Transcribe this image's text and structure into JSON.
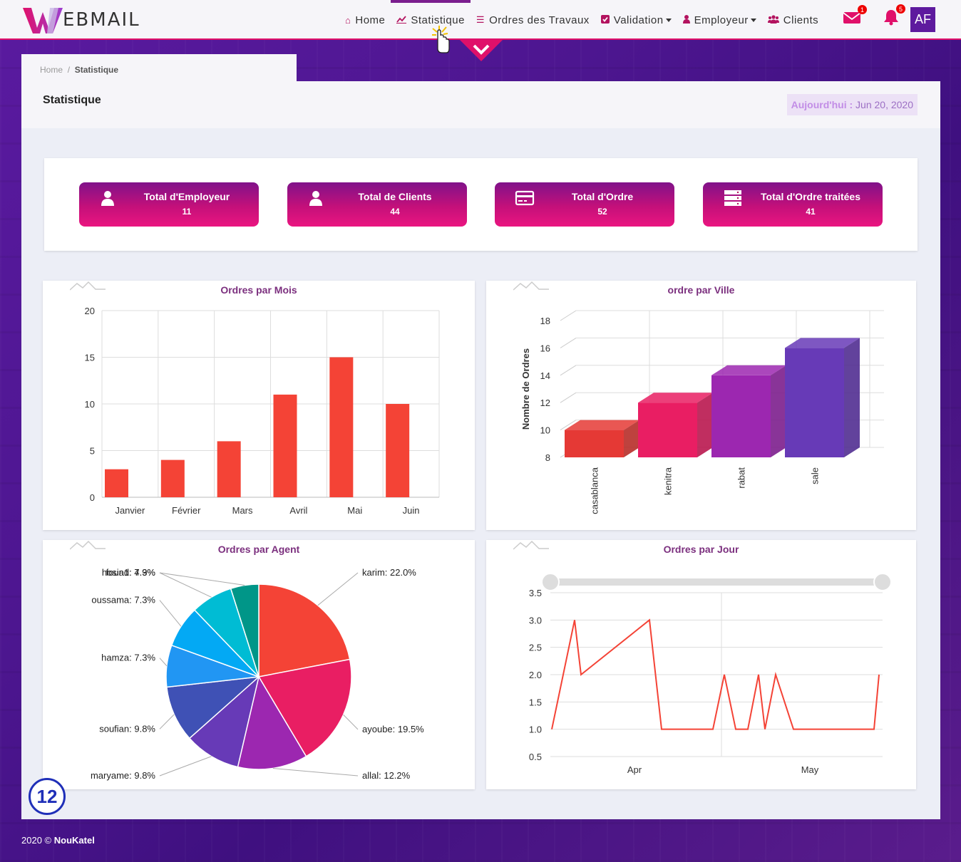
{
  "brand": {
    "logo_letter": "W",
    "logo_text": "EBMAIL"
  },
  "nav": {
    "items": [
      {
        "label": "Home",
        "icon": "home-icon"
      },
      {
        "label": "Statistique",
        "icon": "chart-line-icon",
        "active": true
      },
      {
        "label": "Ordres des Travaux",
        "icon": "list-icon"
      },
      {
        "label": "Validation",
        "icon": "check-square-icon",
        "dropdown": true
      },
      {
        "label": "Employeur",
        "icon": "user-icon",
        "dropdown": true
      },
      {
        "label": "Clients",
        "icon": "users-icon"
      }
    ],
    "mail_badge": "1",
    "bell_badge": "5",
    "avatar": "AF"
  },
  "breadcrumb": {
    "home": "Home",
    "separator": "/",
    "current": "Statistique"
  },
  "page": {
    "title": "Statistique",
    "date_label": "Aujourd'hui :",
    "date_value": "Jun 20, 2020"
  },
  "kpis": [
    {
      "label": "Total d'Employeur",
      "value": "11",
      "icon": "user-icon"
    },
    {
      "label": "Total de Clients",
      "value": "44",
      "icon": "user-icon"
    },
    {
      "label": "Total d'Ordre",
      "value": "52",
      "icon": "credit-card-icon"
    },
    {
      "label": "Total d'Ordre traitées",
      "value": "41",
      "icon": "server-icon"
    }
  ],
  "chart_data": [
    {
      "type": "bar",
      "title": "Ordres par Mois",
      "categories": [
        "Janvier",
        "Février",
        "Mars",
        "Avril",
        "Mai",
        "Juin"
      ],
      "values": [
        3,
        4,
        6,
        11,
        15,
        10
      ],
      "ylim": [
        0,
        20
      ],
      "yticks": [
        "0",
        "5",
        "10",
        "15",
        "20"
      ],
      "color": "#f44336",
      "grid": true
    },
    {
      "type": "bar",
      "title": "ordre par Ville",
      "ylabel": "Nombre de Ordres",
      "categories": [
        "casablanca",
        "kenitra",
        "rabat",
        "sale"
      ],
      "values": [
        10,
        12,
        14,
        16
      ],
      "ylim": [
        8,
        18
      ],
      "yticks": [
        "8",
        "10",
        "12",
        "14",
        "16",
        "18"
      ],
      "colors": [
        "#e53935",
        "#e91e63",
        "#9c27b0",
        "#673ab7"
      ],
      "style": "3d"
    },
    {
      "type": "pie",
      "title": "Ordres par Agent",
      "slices": [
        {
          "label": "karim",
          "value": 22.0,
          "text": "karim: 22.0%",
          "color": "#f44336"
        },
        {
          "label": "ayoube",
          "value": 19.5,
          "text": "ayoube: 19.5%",
          "color": "#e91e63"
        },
        {
          "label": "allal",
          "value": 12.2,
          "text": "allal: 12.2%",
          "color": "#9c27b0"
        },
        {
          "label": "maryame",
          "value": 9.8,
          "text": "maryame: 9.8%",
          "color": "#673ab7"
        },
        {
          "label": "soufian",
          "value": 9.8,
          "text": "soufian: 9.8%",
          "color": "#3f51b5"
        },
        {
          "label": "hamza",
          "value": 7.3,
          "text": "hamza: 7.3%",
          "color": "#2196f3"
        },
        {
          "label": "oussama",
          "value": 7.3,
          "text": "oussama: 7.3%",
          "color": "#03a9f4"
        },
        {
          "label": "fouad",
          "value": 7.3,
          "text": "fouad: 7.3%",
          "color": "#00bcd4"
        },
        {
          "label": "hosin1",
          "value": 4.9,
          "text": "hosin1: 4.9%",
          "color": "#009688"
        }
      ]
    },
    {
      "type": "line",
      "title": "Ordres par Jour",
      "x_ticks": [
        "Apr",
        "May"
      ],
      "ylim": [
        0.5,
        3.5
      ],
      "yticks": [
        "0.5",
        "1.0",
        "1.5",
        "2.0",
        "2.5",
        "3.0",
        "3.5"
      ],
      "values": [
        1,
        3,
        2,
        3,
        1,
        1,
        2,
        1,
        1,
        2,
        1,
        2,
        1,
        1,
        2
      ],
      "color": "#f44336",
      "scrollbar": true
    }
  ],
  "footer": {
    "year": "2020 ©",
    "company": "NouKatel"
  },
  "step": "12"
}
